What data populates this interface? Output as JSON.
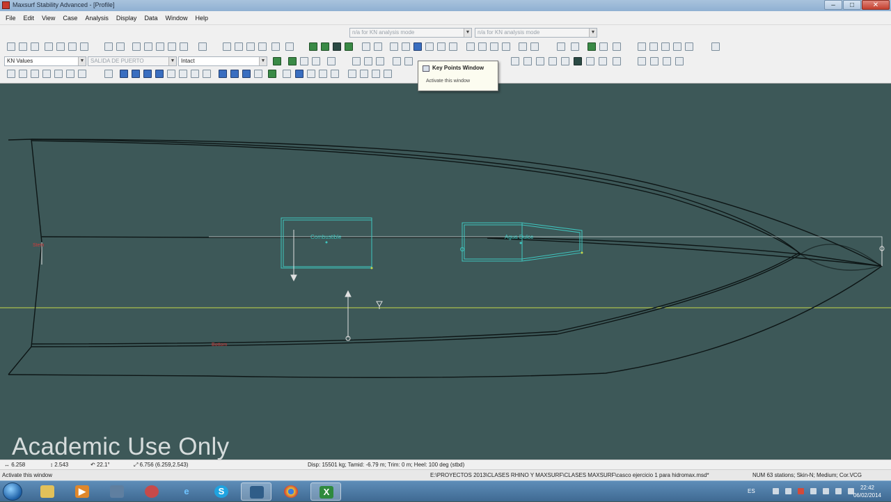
{
  "window": {
    "title": "Maxsurf Stability Advanced - [Profile]"
  },
  "menu": [
    "File",
    "Edit",
    "View",
    "Case",
    "Analysis",
    "Display",
    "Data",
    "Window",
    "Help"
  ],
  "toolbar": {
    "kn_mode_combo_1": "n/a for KN analysis mode",
    "kn_mode_combo_2": "n/a for KN analysis mode",
    "analysis_type": "KN Values",
    "loadcase": "SALIDA DE PUERTO",
    "damage_case": "Intact"
  },
  "tooltip": {
    "title": "Key Points Window",
    "body": "Activate this window"
  },
  "canvas": {
    "labels": {
      "tank1": "Combustible",
      "tank2": "Agua Dulce",
      "keypoint_left": "Stem",
      "keypoint_bottom": "Bottom"
    },
    "colors": {
      "background": "#3d5858",
      "hull_line": "#0d1515",
      "tank_outline": "#3fc7c0",
      "waterline": "#c7d84a",
      "marker": "#d23a3a"
    }
  },
  "watermark": "Academic Use Only",
  "status": {
    "x": "6.258",
    "y": "2.543",
    "angle": "22.1°",
    "point": "6.756 (6.259,2.543)",
    "hydro": "Disp: 15501 kg; Tamid: -6.79 m; Trim: 0 m; Heel: 100 deg (stbd)",
    "hint": "Activate this window",
    "file_path": "E:\\PROYECTOS 2013\\CLASES RHINO Y MAXSURF\\CLASES MAXSURF\\casco ejercicio 1 para hidromax.msd*",
    "indicators": "NUM   63 stations; Skin-N; Medium; Cor.VCG"
  },
  "taskbar": {
    "lang": "ES",
    "time": "22:42",
    "date": "06/02/2014"
  }
}
